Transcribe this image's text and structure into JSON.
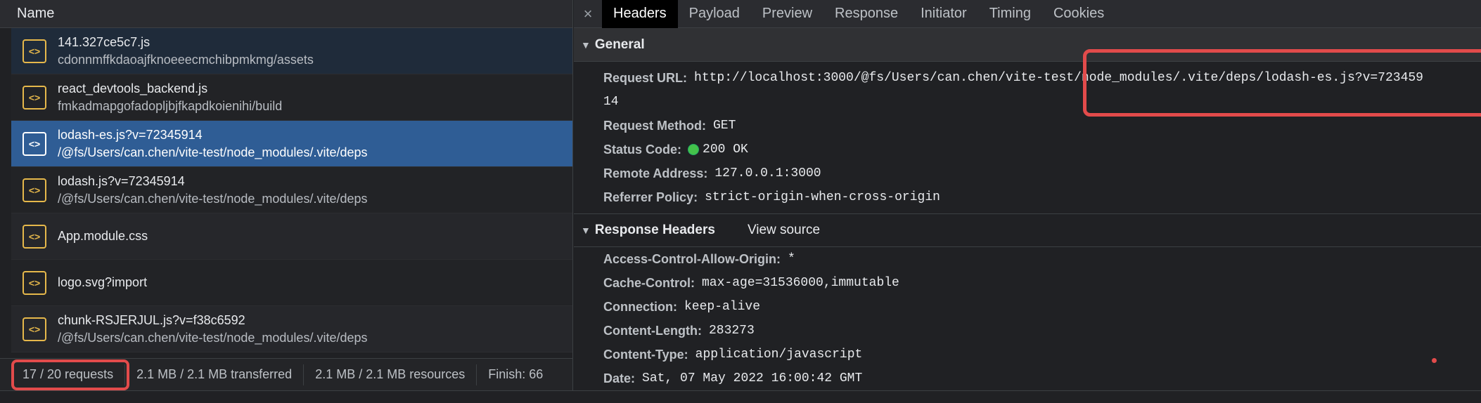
{
  "left": {
    "header": "Name",
    "rows": [
      {
        "name": "141.327ce5c7.js",
        "path": "cdonnmffkdaoajfknoeeecmchibpmkmg/assets"
      },
      {
        "name": "react_devtools_backend.js",
        "path": "fmkadmapgofadopljbjfkapdkoienihi/build"
      },
      {
        "name": "lodash-es.js?v=72345914",
        "path": "/@fs/Users/can.chen/vite-test/node_modules/.vite/deps"
      },
      {
        "name": "lodash.js?v=72345914",
        "path": "/@fs/Users/can.chen/vite-test/node_modules/.vite/deps"
      },
      {
        "name": "App.module.css",
        "path": ""
      },
      {
        "name": "logo.svg?import",
        "path": ""
      },
      {
        "name": "chunk-RSJERJUL.js?v=f38c6592",
        "path": "/@fs/Users/can.chen/vite-test/node_modules/.vite/deps"
      }
    ],
    "icon_glyph": "<>",
    "status": {
      "requests": "17 / 20 requests",
      "transferred": "2.1 MB / 2.1 MB transferred",
      "resources": "2.1 MB / 2.1 MB resources",
      "finish": "Finish: 66"
    }
  },
  "right": {
    "close": "×",
    "tabs": [
      "Headers",
      "Payload",
      "Preview",
      "Response",
      "Initiator",
      "Timing",
      "Cookies"
    ],
    "general": {
      "title": "General",
      "request_url_key": "Request URL:",
      "request_url_val": "http://localhost:3000/@fs/Users/can.chen/vite-test/node_modules/.vite/deps/lodash-es.js?v=72345914",
      "request_url_val_line1": "http://localhost:3000/@fs/Users/can.chen/vite-test/node_modules/.vite/deps/lodash-es.js?v=723459",
      "request_url_val_line2": "14",
      "method_key": "Request Method:",
      "method_val": "GET",
      "status_key": "Status Code:",
      "status_val": "200 OK",
      "remote_key": "Remote Address:",
      "remote_val": "127.0.0.1:3000",
      "referrer_key": "Referrer Policy:",
      "referrer_val": "strict-origin-when-cross-origin"
    },
    "response": {
      "title": "Response Headers",
      "view_source": "View source",
      "headers": [
        {
          "k": "Access-Control-Allow-Origin:",
          "v": "*"
        },
        {
          "k": "Cache-Control:",
          "v": "max-age=31536000,immutable"
        },
        {
          "k": "Connection:",
          "v": "keep-alive"
        },
        {
          "k": "Content-Length:",
          "v": "283273"
        },
        {
          "k": "Content-Type:",
          "v": "application/javascript"
        },
        {
          "k": "Date:",
          "v": "Sat, 07 May 2022 16:00:42 GMT"
        }
      ]
    }
  },
  "colors": {
    "selection": "#2f5d95",
    "highlight_box": "#e24b4b",
    "status_ok": "#44c24a",
    "file_icon": "#e6b84b"
  }
}
